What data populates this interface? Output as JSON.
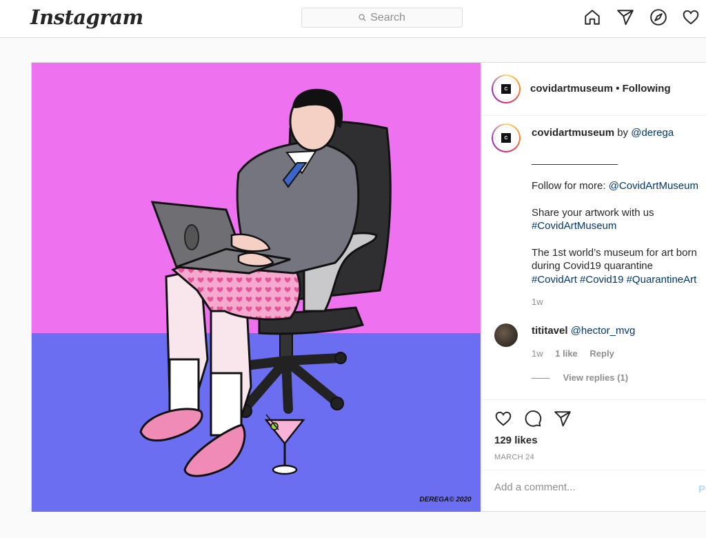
{
  "header": {
    "logo": "Instagram",
    "search_placeholder": "Search",
    "icons": [
      "home-icon",
      "direct-icon",
      "explore-icon",
      "activity-icon"
    ]
  },
  "post": {
    "artist_signature": "DEREGA© 2020",
    "author": {
      "username": "covidartmuseum",
      "follow_status": "• Following",
      "avatar_text": "C"
    },
    "caption": {
      "username": "covidartmuseum",
      "by_word": "by",
      "by_handle": "@derega",
      "divider": "_______________",
      "follow_prefix": "Follow for more:",
      "follow_handle": "@CovidArtMuseum",
      "share_line": "Share your artwork with us",
      "share_tag": "#CovidArtMuseum",
      "museum_line1": "The 1st world’s museum for art born",
      "museum_line2": "during Covid19 quarantine",
      "tag1": "#CovidArt",
      "tag2": "#Covid19",
      "tag3": "#QuarantineArt",
      "time": "1w"
    },
    "comment": {
      "username": "tititavel",
      "mention": "@hector_mvg",
      "time": "1w",
      "likes": "1 like",
      "reply": "Reply",
      "view_replies": "View replies (1)"
    },
    "likes": "129 likes",
    "date": "MARCH 24",
    "add_comment_placeholder": "Add a comment...",
    "post_button": "Post"
  },
  "colors": {
    "wall": "#ee72f0",
    "floor": "#6c6ef2",
    "link": "#00376b"
  }
}
